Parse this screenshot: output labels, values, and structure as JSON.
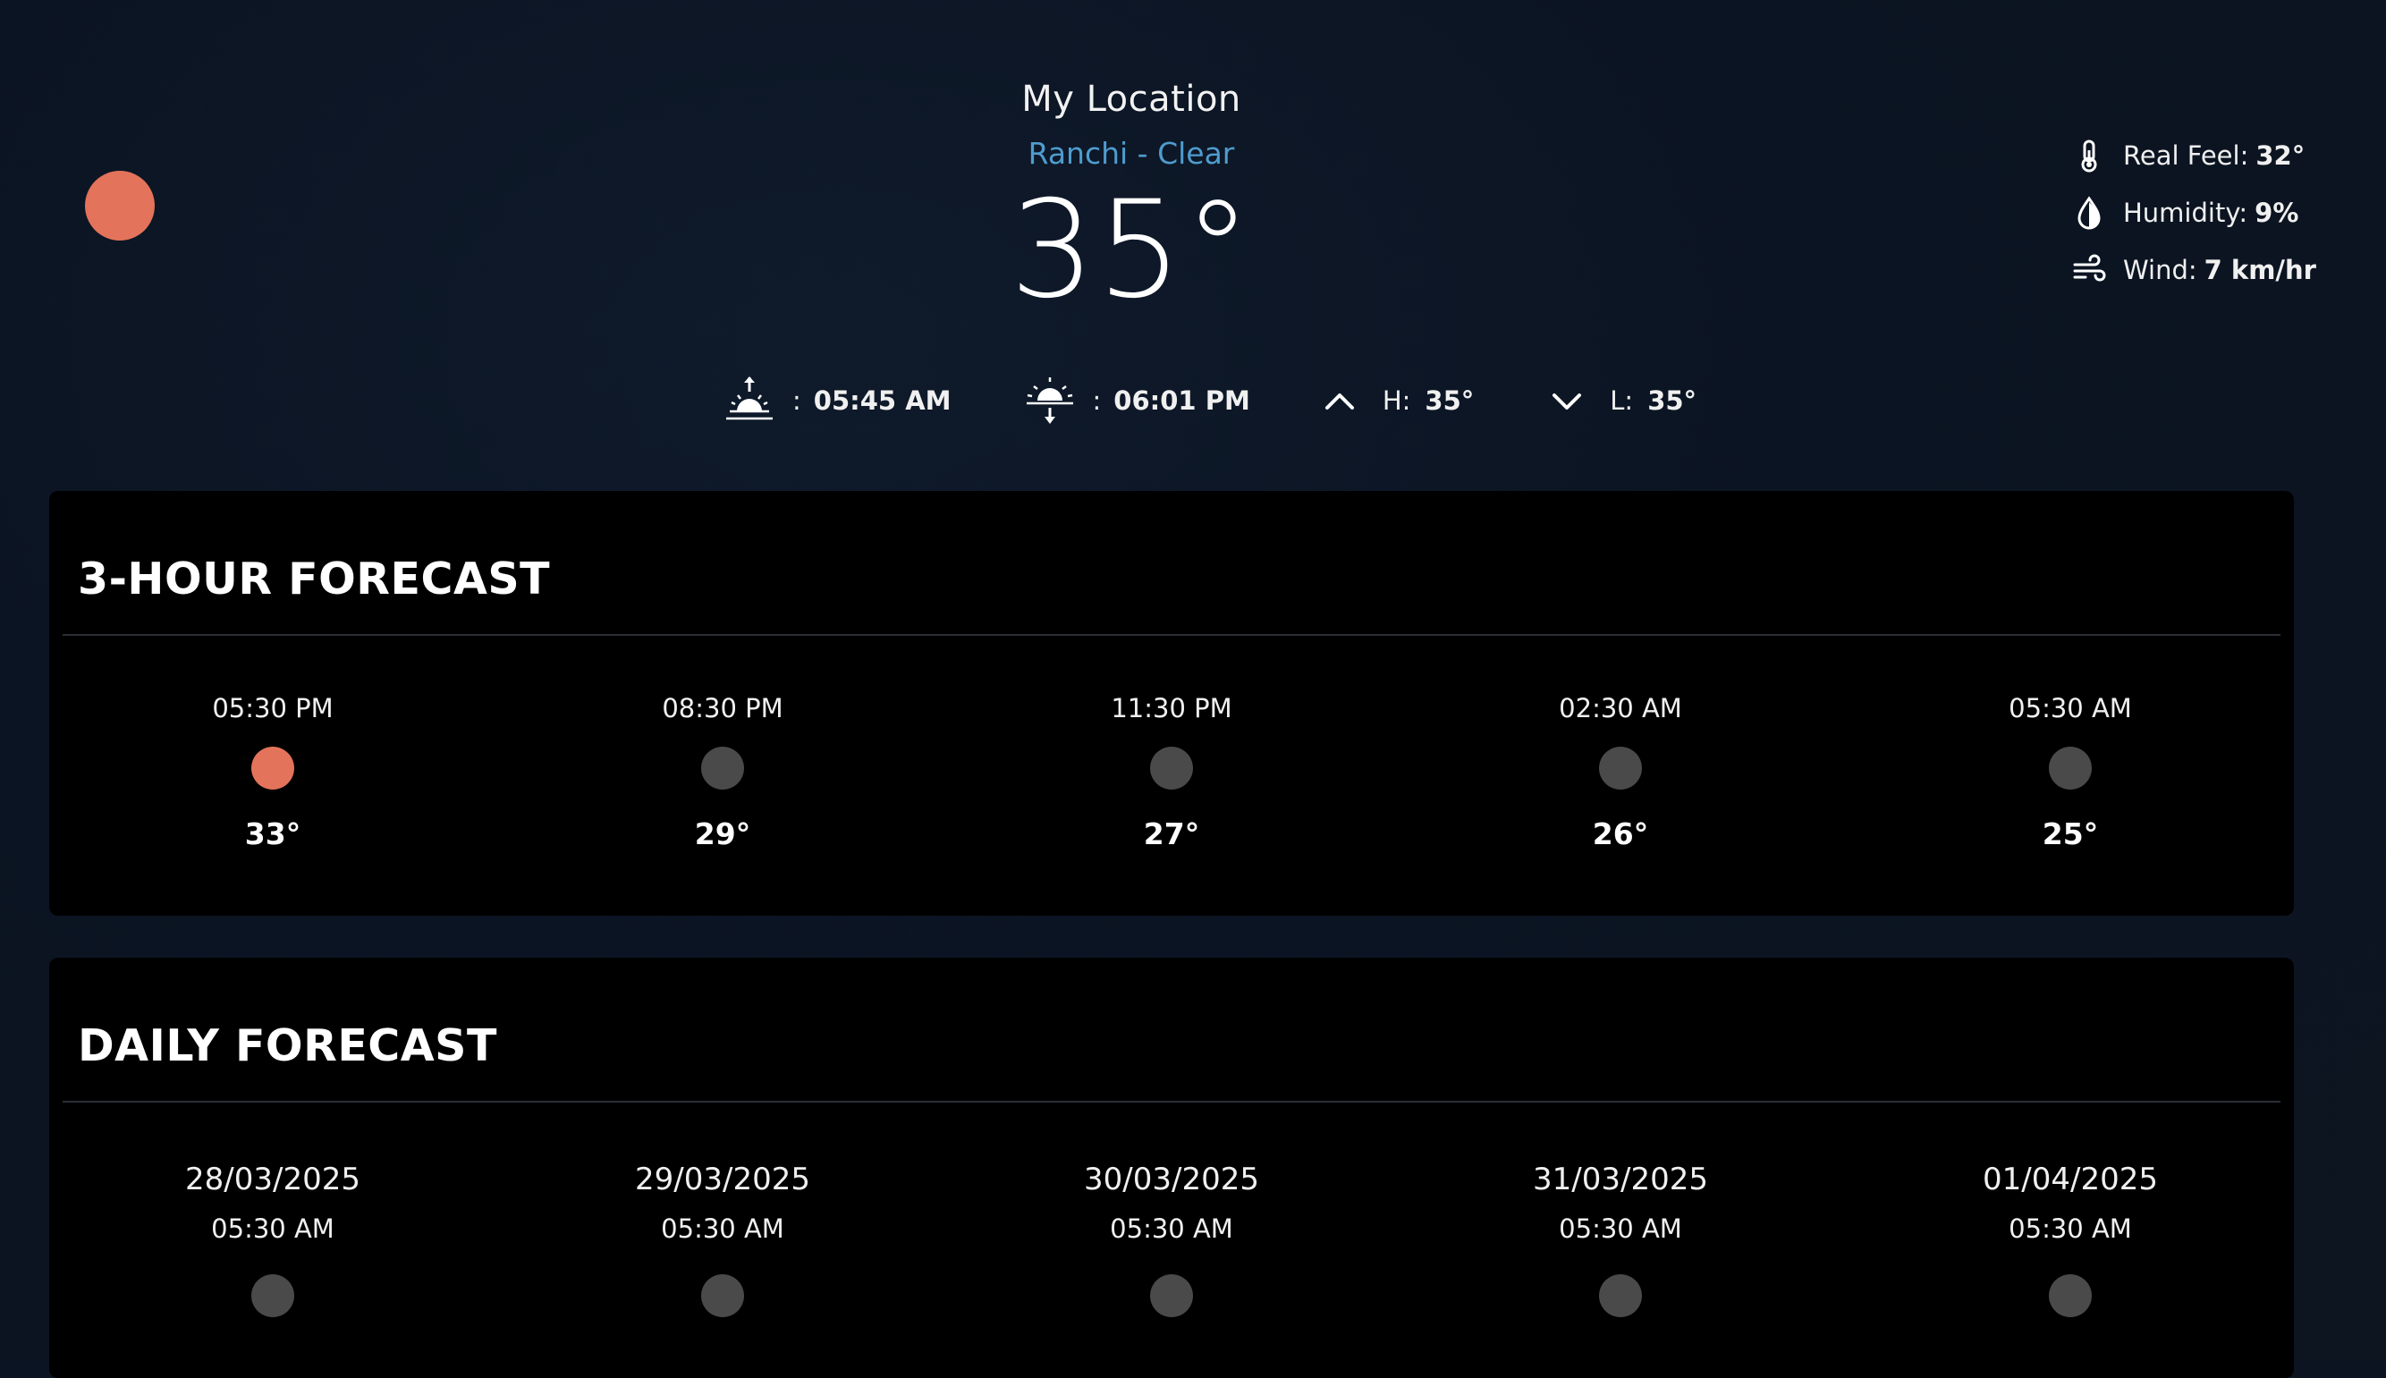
{
  "header": {
    "title": "My Location",
    "subtitle": "Ranchi - Clear",
    "temperature": "35°"
  },
  "colors": {
    "sun_accent": "#e3735a",
    "neutral_dot": "#4a4a4a",
    "subtitle_blue": "#4f9ccf"
  },
  "details": {
    "real_feel_label": "Real Feel:",
    "real_feel_value": "32°",
    "humidity_label": "Humidity:",
    "humidity_value": "9%",
    "wind_label": "Wind:",
    "wind_value": "7 km/hr"
  },
  "sun": {
    "sunrise_colon": ":",
    "sunrise_time": "05:45 AM",
    "sunset_colon": ":",
    "sunset_time": "06:01 PM",
    "high_label": "H:",
    "high_value": "35°",
    "low_label": "L:",
    "low_value": "35°"
  },
  "hourly": {
    "title": "3-HOUR FORECAST",
    "items": [
      {
        "time": "05:30 PM",
        "temp": "33°",
        "icon": "sun-icon"
      },
      {
        "time": "08:30 PM",
        "temp": "29°",
        "icon": "moon-icon"
      },
      {
        "time": "11:30 PM",
        "temp": "27°",
        "icon": "moon-icon"
      },
      {
        "time": "02:30 AM",
        "temp": "26°",
        "icon": "moon-icon"
      },
      {
        "time": "05:30 AM",
        "temp": "25°",
        "icon": "moon-icon"
      }
    ]
  },
  "daily": {
    "title": "DAILY FORECAST",
    "items": [
      {
        "date": "28/03/2025",
        "time": "05:30 AM",
        "icon": "moon-icon"
      },
      {
        "date": "29/03/2025",
        "time": "05:30 AM",
        "icon": "moon-icon"
      },
      {
        "date": "30/03/2025",
        "time": "05:30 AM",
        "icon": "moon-icon"
      },
      {
        "date": "31/03/2025",
        "time": "05:30 AM",
        "icon": "moon-icon"
      },
      {
        "date": "01/04/2025",
        "time": "05:30 AM",
        "icon": "moon-icon"
      }
    ]
  }
}
